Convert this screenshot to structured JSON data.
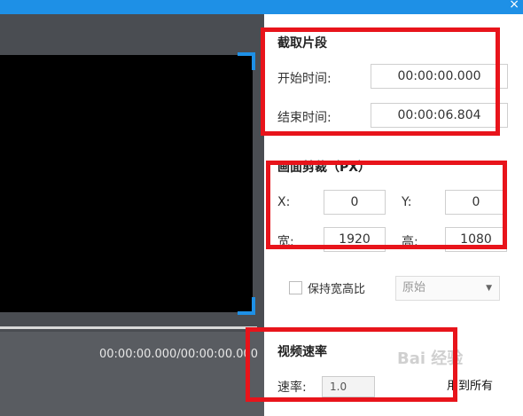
{
  "window": {
    "close_glyph": "×"
  },
  "player": {
    "timecode": "00:00:00.000/00:00:00.000"
  },
  "clip": {
    "title": "截取片段",
    "start_label": "开始时间:",
    "start_value": "00:00:00.000",
    "end_label": "结束时间:",
    "end_value": "00:00:06.804"
  },
  "crop": {
    "title": "画面剪裁（PX）",
    "x_label": "X:",
    "x_value": "0",
    "y_label": "Y:",
    "y_value": "0",
    "width_label": "宽:",
    "width_value": "1920",
    "height_label": "高:",
    "height_value": "1080",
    "keep_ratio_label": "保持宽高比",
    "keep_ratio_checked": false,
    "ratio_select_value": "原始"
  },
  "speed": {
    "title": "视频速率",
    "rate_label": "速率:",
    "rate_value": "1.0",
    "apply_all_label": "用到所有"
  },
  "watermark": "Bai 经验",
  "colors": {
    "accent": "#1e90e6",
    "annotation_red": "#e8141b",
    "player_bg": "#4a4d52"
  }
}
